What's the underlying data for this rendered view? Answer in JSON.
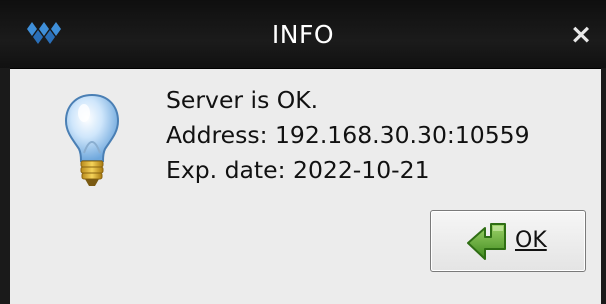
{
  "window": {
    "title": "INFO",
    "close_glyph": "×",
    "app_icon": "app-logo-icon"
  },
  "message": {
    "icon": "lightbulb-icon",
    "lines": [
      "Server is OK.",
      "Address: 192.168.30.30:10559",
      "Exp. date: 2022-10-21"
    ]
  },
  "buttons": {
    "ok": {
      "label": "OK",
      "icon": "green-arrow-icon"
    }
  },
  "colors": {
    "titlebar": "#151515",
    "title_text": "#ffffff",
    "dialog_background": "#ececec",
    "ok_icon_green": "#4f9a2a"
  }
}
